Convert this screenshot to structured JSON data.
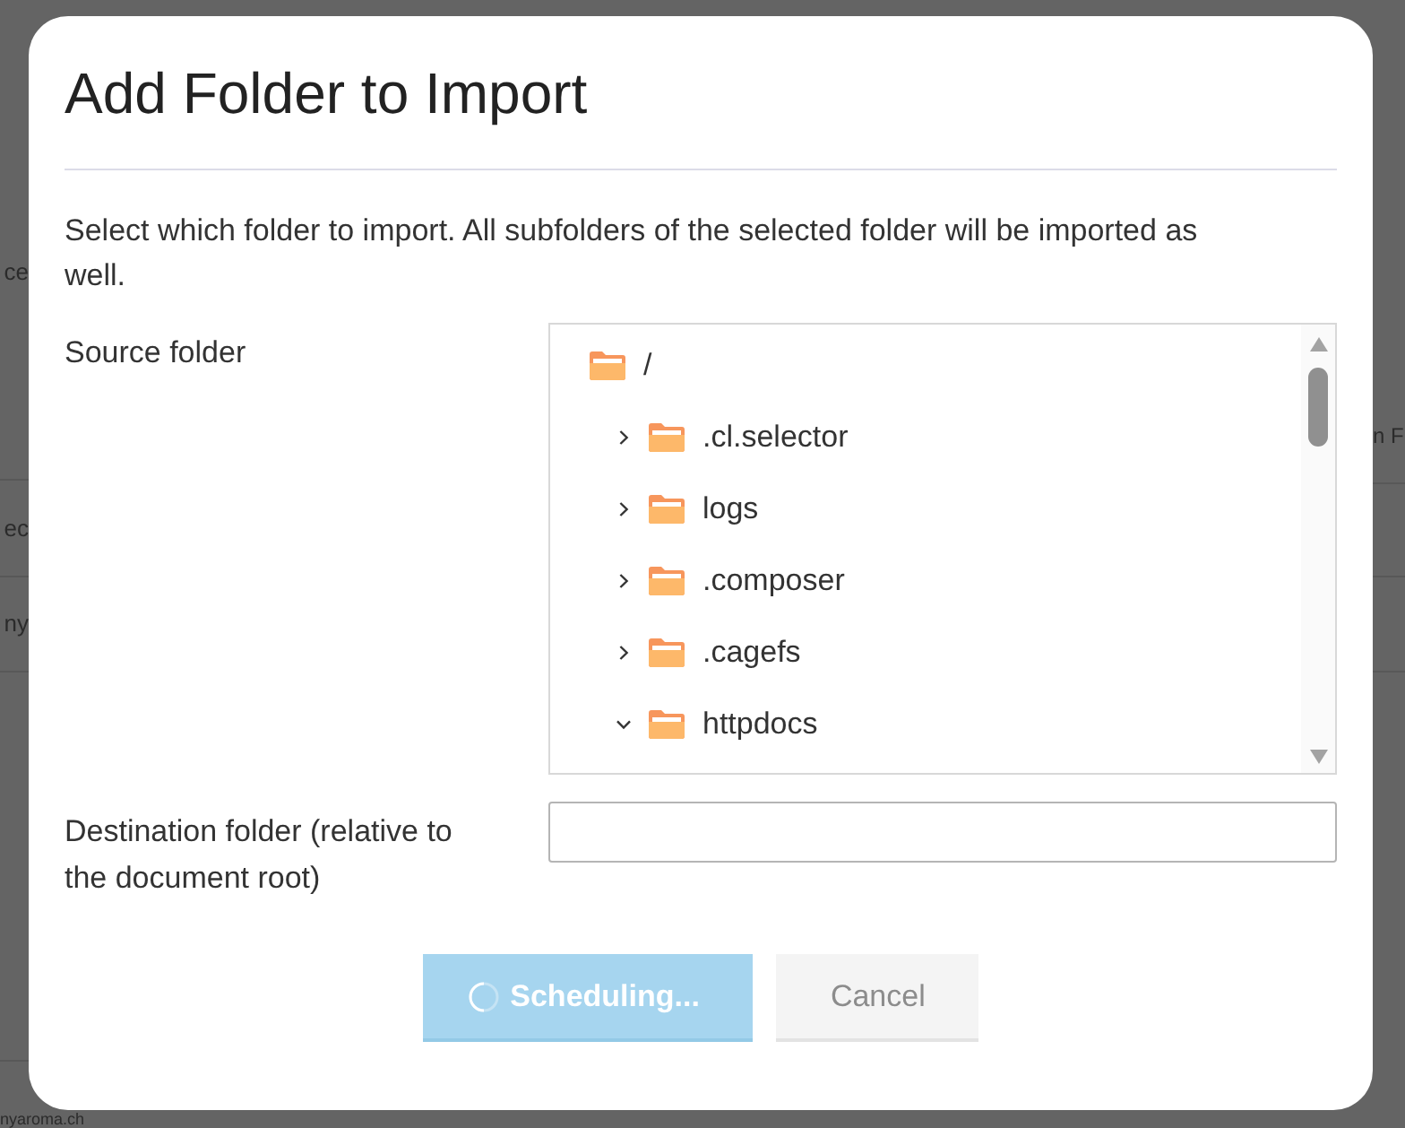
{
  "background_page": {
    "left_fragments": [
      "ce",
      "ec",
      "ny"
    ],
    "right_fragment": "n F",
    "bottom_fragment": "nyaroma.ch"
  },
  "dialog": {
    "title": "Add Folder to Import",
    "description": "Select which folder to import. All subfolders of the selected folder will be imported as well.",
    "source_folder": {
      "label": "Source folder",
      "tree": [
        {
          "label": "/",
          "children": [
            {
              "label": ".cl.selector",
              "expanded": false
            },
            {
              "label": "logs",
              "expanded": false
            },
            {
              "label": ".composer",
              "expanded": false
            },
            {
              "label": ".cagefs",
              "expanded": false
            },
            {
              "label": "httpdocs",
              "expanded": true
            }
          ]
        }
      ]
    },
    "destination_folder": {
      "label": "Destination folder (relative to the document root)"
    },
    "buttons": [
      {
        "kind": "primary",
        "label": "Scheduling...",
        "busy": true,
        "disabled": true
      },
      {
        "kind": "secondary",
        "label": "Cancel",
        "disabled": true
      }
    ]
  }
}
